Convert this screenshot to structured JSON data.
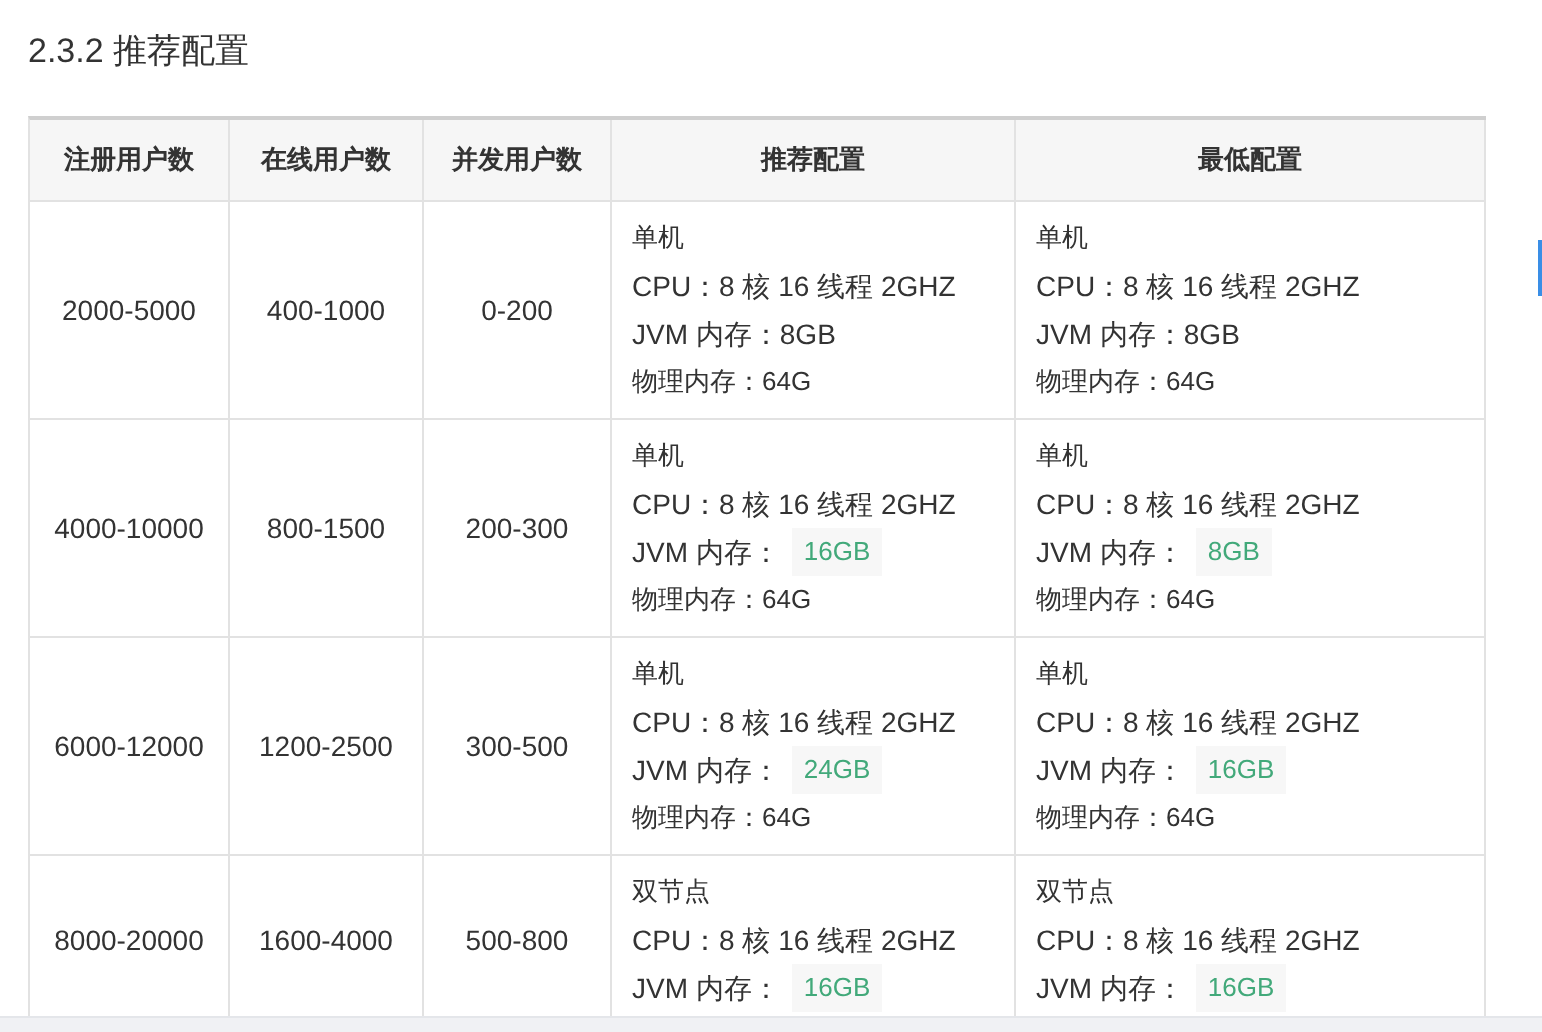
{
  "heading": "2.3.2 推荐配置",
  "table": {
    "columns": [
      "注册用户数",
      "在线用户数",
      "并发用户数",
      "推荐配置",
      "最低配置"
    ],
    "rows": [
      {
        "registered": "2000-5000",
        "online": "400-1000",
        "concurrent": "0-200",
        "recommended": {
          "mode": "单机",
          "cpu": "CPU：8 核 16 线程 2GHZ",
          "jvm_label": "JVM 内存：",
          "jvm_value": "8GB",
          "jvm_highlighted": false,
          "memory": "物理内存：64G"
        },
        "minimum": {
          "mode": "单机",
          "cpu": "CPU：8 核 16 线程 2GHZ",
          "jvm_label": "JVM 内存：",
          "jvm_value": "8GB",
          "jvm_highlighted": false,
          "memory": "物理内存：64G"
        }
      },
      {
        "registered": "4000-10000",
        "online": "800-1500",
        "concurrent": "200-300",
        "recommended": {
          "mode": "单机",
          "cpu": "CPU：8 核 16 线程 2GHZ",
          "jvm_label": "JVM 内存：",
          "jvm_value": "16GB",
          "jvm_highlighted": true,
          "memory": "物理内存：64G"
        },
        "minimum": {
          "mode": "单机",
          "cpu": "CPU：8 核 16 线程 2GHZ",
          "jvm_label": "JVM 内存：",
          "jvm_value": "8GB",
          "jvm_highlighted": true,
          "memory": "物理内存：64G"
        }
      },
      {
        "registered": "6000-12000",
        "online": "1200-2500",
        "concurrent": "300-500",
        "recommended": {
          "mode": "单机",
          "cpu": "CPU：8 核 16 线程 2GHZ",
          "jvm_label": "JVM 内存：",
          "jvm_value": "24GB",
          "jvm_highlighted": true,
          "memory": "物理内存：64G"
        },
        "minimum": {
          "mode": "单机",
          "cpu": "CPU：8 核 16 线程 2GHZ",
          "jvm_label": "JVM 内存：",
          "jvm_value": "16GB",
          "jvm_highlighted": true,
          "memory": "物理内存：64G"
        }
      },
      {
        "registered": "8000-20000",
        "online": "1600-4000",
        "concurrent": "500-800",
        "recommended": {
          "mode": "双节点",
          "cpu": "CPU：8 核 16 线程 2GHZ",
          "jvm_label": "JVM 内存：",
          "jvm_value": "16GB",
          "jvm_highlighted": true
        },
        "minimum": {
          "mode": "双节点",
          "cpu": "CPU：8 核 16 线程 2GHZ",
          "jvm_label": "JVM 内存：",
          "jvm_value": "16GB",
          "jvm_highlighted": true
        }
      }
    ]
  }
}
